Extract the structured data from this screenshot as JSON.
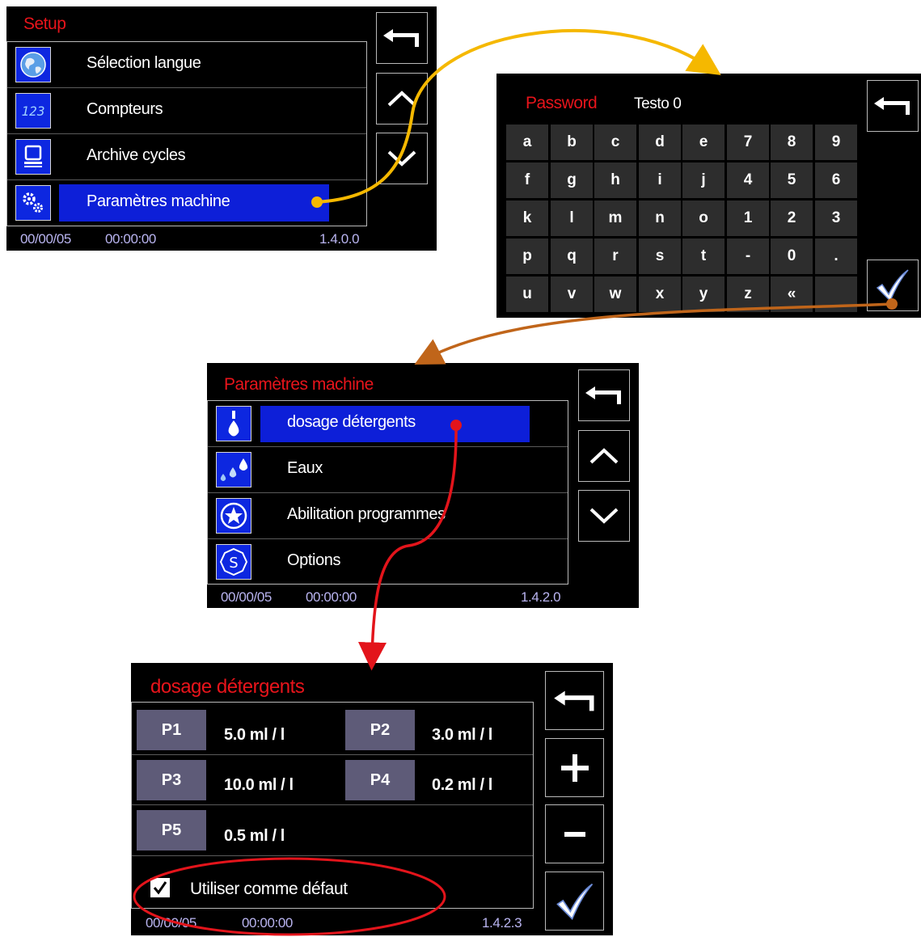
{
  "setup": {
    "title": "Setup",
    "items": [
      {
        "label": "Sélection langue",
        "icon": "globe-icon"
      },
      {
        "label": "Compteurs",
        "icon": "counter-123-icon",
        "icon_text": "123"
      },
      {
        "label": "Archive cycles",
        "icon": "computer-icon"
      },
      {
        "label": "Paramètres machine",
        "icon": "gears-icon"
      }
    ],
    "selected_index": 3,
    "status": {
      "date": "00/00/05",
      "time": "00:00:00",
      "version": "1.4.0.0"
    },
    "buttons": [
      "back-arrow-icon",
      "chevron-up-icon",
      "chevron-down-icon"
    ]
  },
  "password": {
    "title": "Password",
    "value": "Testo 0",
    "keys": [
      [
        "a",
        "b",
        "c",
        "d",
        "e",
        "7",
        "8",
        "9"
      ],
      [
        "f",
        "g",
        "h",
        "i",
        "j",
        "4",
        "5",
        "6"
      ],
      [
        "k",
        "l",
        "m",
        "n",
        "o",
        "1",
        "2",
        "3"
      ],
      [
        "p",
        "q",
        "r",
        "s",
        "t",
        "-",
        "0",
        "."
      ],
      [
        "u",
        "v",
        "w",
        "x",
        "y",
        "z",
        "«",
        ""
      ]
    ],
    "buttons": [
      "back-arrow-icon",
      "checkmark-icon"
    ]
  },
  "machine_params": {
    "title": "Paramètres machine",
    "items": [
      {
        "label": "dosage détergents",
        "icon": "drop-dispenser-icon"
      },
      {
        "label": "Eaux",
        "icon": "water-drops-icon"
      },
      {
        "label": "Abilitation programmes",
        "icon": "star-circle-icon"
      },
      {
        "label": "Options",
        "icon": "options-s-icon",
        "icon_text": "S"
      }
    ],
    "selected_index": 0,
    "status": {
      "date": "00/00/05",
      "time": "00:00:00",
      "version": "1.4.2.0"
    }
  },
  "dosage": {
    "title": "dosage détergents",
    "pumps": [
      {
        "label": "P1",
        "value": "5.0 ml / l"
      },
      {
        "label": "P2",
        "value": "3.0 ml / l"
      },
      {
        "label": "P3",
        "value": "10.0 ml / l"
      },
      {
        "label": "P4",
        "value": "0.2 ml / l"
      },
      {
        "label": "P5",
        "value": "0.5 ml / l"
      }
    ],
    "default_checkbox": {
      "label": "Utiliser comme défaut",
      "checked": true
    },
    "status": {
      "date": "00/00/05",
      "time": "00:00:00",
      "version": "1.4.2.3"
    },
    "buttons": [
      "back-arrow-icon",
      "plus-icon",
      "minus-icon",
      "checkmark-icon"
    ]
  },
  "colors": {
    "title_red": "#e8141b",
    "selection_blue": "#0d1fd8",
    "arrow_yellow": "#f5b800",
    "arrow_brown": "#c0651a",
    "arrow_red": "#e3141b",
    "status_text": "#b9b4f0",
    "key_bg": "#2d2d2d",
    "pump_button_bg": "#5e5b78"
  }
}
